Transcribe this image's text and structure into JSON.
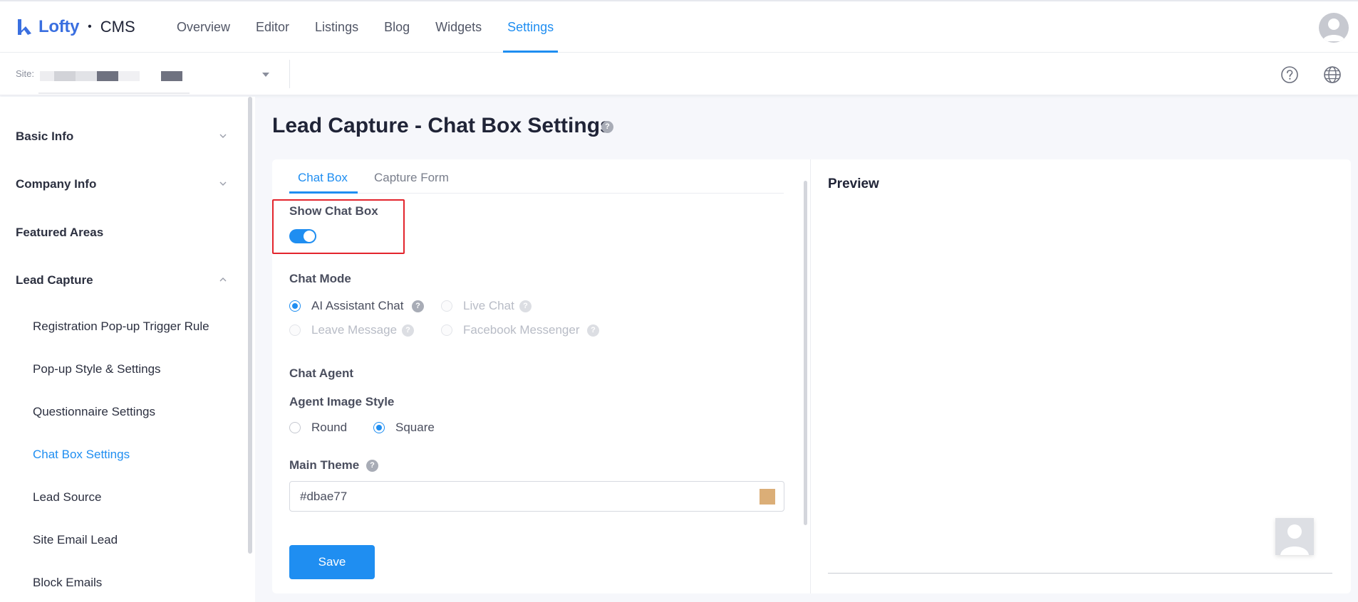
{
  "app": {
    "brand": "Lofty",
    "separator": "•",
    "product": "CMS"
  },
  "nav": {
    "items": [
      "Overview",
      "Editor",
      "Listings",
      "Blog",
      "Widgets",
      "Settings"
    ],
    "active": "Settings"
  },
  "subbar": {
    "site_label": "Site:"
  },
  "sidebar": {
    "groups": [
      {
        "label": "Basic Info",
        "state": "collapsed"
      },
      {
        "label": "Company Info",
        "state": "collapsed"
      },
      {
        "label": "Featured Areas"
      },
      {
        "label": "Lead Capture",
        "state": "expanded"
      }
    ],
    "lead_capture_items": [
      "Registration Pop-up Trigger Rule",
      "Pop-up Style & Settings",
      "Questionnaire Settings",
      "Chat Box Settings",
      "Lead Source",
      "Site Email Lead",
      "Block Emails"
    ],
    "active_item": "Chat Box Settings"
  },
  "page": {
    "title": "Lead Capture - Chat Box Settings"
  },
  "tabs": {
    "items": [
      "Chat Box",
      "Capture Form"
    ],
    "active": "Chat Box"
  },
  "form": {
    "show_chat_box_label": "Show Chat Box",
    "show_chat_box_on": true,
    "chat_mode_label": "Chat Mode",
    "chat_modes": [
      {
        "label": "AI Assistant Chat",
        "checked": true,
        "disabled": false
      },
      {
        "label": "Live Chat",
        "checked": false,
        "disabled": true
      },
      {
        "label": "Leave Message",
        "checked": false,
        "disabled": true
      },
      {
        "label": "Facebook Messenger",
        "checked": false,
        "disabled": true
      }
    ],
    "chat_agent_label": "Chat Agent",
    "agent_image_style_label": "Agent Image Style",
    "image_styles": [
      {
        "label": "Round",
        "checked": false
      },
      {
        "label": "Square",
        "checked": true
      }
    ],
    "main_theme_label": "Main Theme",
    "main_theme_value": "#dbae77",
    "save_label": "Save"
  },
  "preview": {
    "title": "Preview"
  },
  "colors": {
    "accent": "#1f8ef1",
    "theme": "#dbae77",
    "highlight": "#e3252d"
  }
}
